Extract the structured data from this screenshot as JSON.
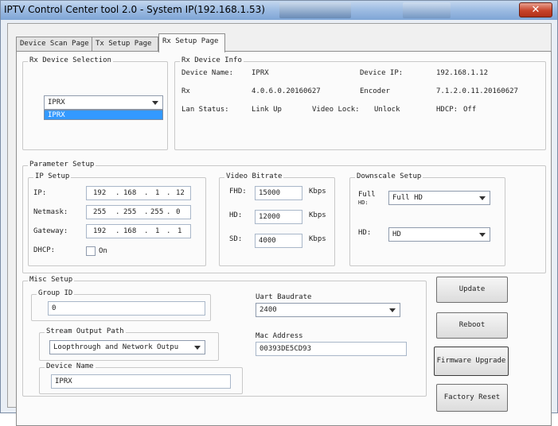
{
  "window": {
    "title": "IPTV Control Center tool 2.0 - System IP(192.168.1.53)",
    "close_glyph": "✕"
  },
  "tabs": [
    {
      "label": "Device Scan Page"
    },
    {
      "label": "Tx Setup Page"
    },
    {
      "label": "Rx Setup Page"
    }
  ],
  "device_selection": {
    "legend": "Rx Device Selection",
    "selected": "IPRX",
    "options": [
      "IPRX"
    ]
  },
  "device_info": {
    "legend": "Rx Device Info",
    "device_name_label": "Device Name:",
    "device_name": "IPRX",
    "device_ip_label": "Device IP:",
    "device_ip": "192.168.1.12",
    "rx_label": "Rx",
    "rx_version": "4.0.6.0.20160627",
    "encoder_label": "Encoder",
    "encoder_version": "7.1.2.0.11.20160627",
    "lan_status_label": "Lan Status:",
    "lan_status": "Link Up",
    "video_lock_label": "Video Lock:",
    "video_lock": "Unlock",
    "hdcp_label": "HDCP:",
    "hdcp": "Off"
  },
  "parameter_setup": {
    "legend": "Parameter Setup",
    "ip_setup": {
      "legend": "IP Setup",
      "ip_label": "IP:",
      "ip": [
        "192",
        "168",
        "1",
        "12"
      ],
      "netmask_label": "Netmask:",
      "netmask": [
        "255",
        "255",
        "255",
        "0"
      ],
      "gateway_label": "Gateway:",
      "gateway": [
        "192",
        "168",
        "1",
        "1"
      ],
      "dhcp_label": "DHCP:",
      "dhcp_option": "On",
      "dot": "."
    },
    "video_bitrate": {
      "legend": "Video Bitrate",
      "fhd_label": "FHD:",
      "fhd": "15000",
      "hd_label": "HD:",
      "hd": "12000",
      "sd_label": "SD:",
      "sd": "4000",
      "unit": "Kbps"
    },
    "downscale_setup": {
      "legend": "Downscale Setup",
      "full_label": "Full",
      "full_sublabel": "HD:",
      "full_value": "Full HD",
      "hd_label": "HD:",
      "hd_value": "HD"
    }
  },
  "misc_setup": {
    "legend": "Misc Setup",
    "group_id_label": "Group ID",
    "group_id": "0",
    "uart_label": "Uart Baudrate",
    "uart_value": "2400",
    "stream_output_label": "Stream Output Path",
    "stream_output_value": "Loopthrough and Network Outpu",
    "mac_label": "Mac Address",
    "mac_value": "00393DE5CD93",
    "device_name_label": "Device Name",
    "device_name": "IPRX"
  },
  "buttons": {
    "update": "Update",
    "reboot": "Reboot",
    "firmware_upgrade": "Firmware Upgrade",
    "factory_reset": "Factory Reset"
  },
  "colors": {
    "annotation_arrow": "#e02020"
  }
}
